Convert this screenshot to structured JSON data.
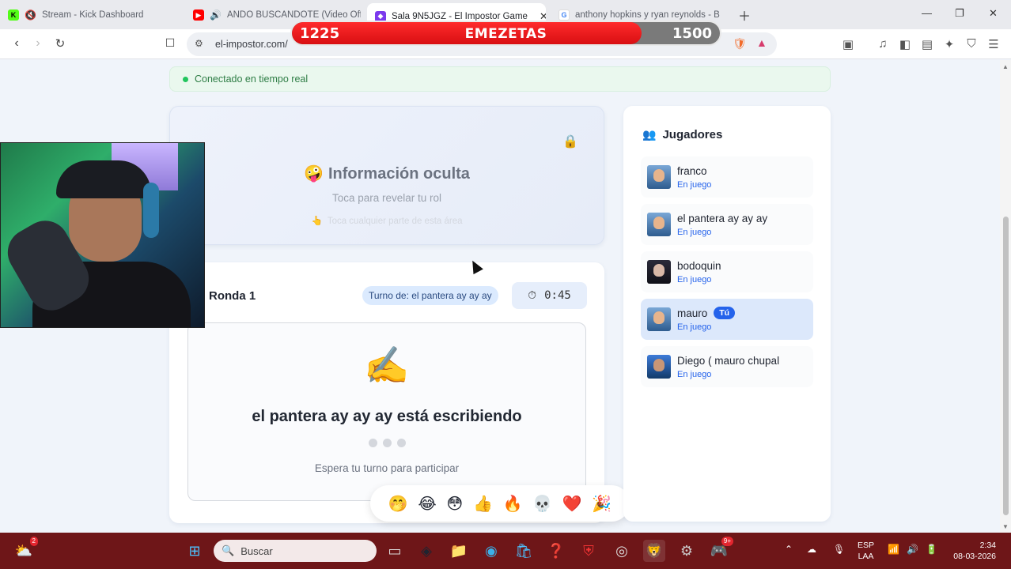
{
  "browser": {
    "tabs": [
      {
        "title": "Stream - Kick Dashboard",
        "favicon": "kick-icon",
        "color": "#53fc18"
      },
      {
        "title": "ANDO BUSCANDOTE (Video Offi...",
        "favicon": "youtube-icon",
        "color": "#ff0000"
      },
      {
        "title": "Sala 9N5JGZ - El Impostor Game",
        "favicon": "impostor-icon",
        "color": "#7c3aed"
      },
      {
        "title": "anthony hopkins y ryan reynolds - B...",
        "favicon": "google-icon",
        "color": "#4285f4"
      }
    ],
    "url": "el-impostor.com/"
  },
  "overlay": {
    "left_score": "1225",
    "label": "EMEZETAS",
    "right_score": "1500",
    "fill_fraction": 0.8167
  },
  "status": {
    "text": "Conectado en tiempo real",
    "color": "#22c55e"
  },
  "reveal": {
    "title": "Información oculta",
    "subtitle": "Toca para revelar tu rol",
    "hint": "Toca cualquier parte de esta área"
  },
  "round": {
    "title": "Ronda 1",
    "turn": "Turno de: el pantera ay ay ay",
    "timer": "0:45",
    "writing": "el pantera ay ay ay está escribiendo",
    "waiting": "Espera tu turno para participar"
  },
  "reactions": [
    "🤭",
    "😂",
    "😳",
    "👍",
    "🔥",
    "💀",
    "❤️",
    "🎉"
  ],
  "players": {
    "heading": "Jugadores",
    "you_badge": "Tú",
    "list": [
      {
        "name": "franco",
        "status": "En juego"
      },
      {
        "name": "el pantera ay ay ay",
        "status": "En juego"
      },
      {
        "name": "bodoquin",
        "status": "En juego"
      },
      {
        "name": "mauro",
        "status": "En juego",
        "is_me": true
      },
      {
        "name": "Diego ( mauro chupal",
        "status": "En juego"
      }
    ]
  },
  "taskbar": {
    "search_placeholder": "Buscar",
    "weather_badge": "2",
    "discord_badge": "9+",
    "lang_line1": "ESP",
    "lang_line2": "LAA",
    "time": "2:34",
    "date": "08-03-2026"
  },
  "colors": {
    "accent": "#2563eb",
    "taskbar": "#6e1618",
    "overlay_red": "#d80f12"
  }
}
